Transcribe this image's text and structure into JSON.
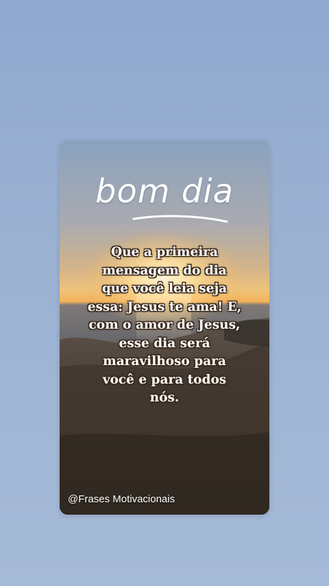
{
  "story": {
    "greeting": "bom dia",
    "message": "Que a primeira mensagem do dia que você leia seja essa: Jesus te ama! E, com o amor de Jesus, esse dia será maravilhoso para você e para todos nós.",
    "handle": "@Frases Motivacionais"
  },
  "colors": {
    "page_background": "#9bb1d2",
    "text": "#ffffff",
    "text_outline": "#3a2a1c",
    "sky_top": "#8aa2bf",
    "sun": "#ffe6a0",
    "sea": "#5e6570",
    "rocks": "#4a3d33"
  }
}
